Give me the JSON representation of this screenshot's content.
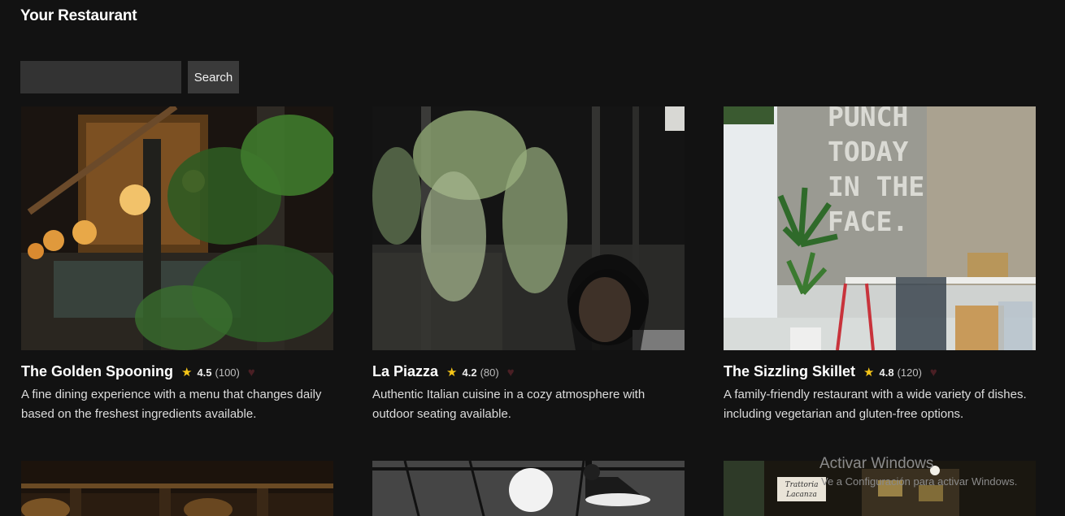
{
  "app": {
    "title": "Your Restaurant"
  },
  "search": {
    "placeholder": "",
    "value": "",
    "button_label": "Search"
  },
  "restaurants": [
    {
      "name": "The Golden Spooning",
      "star": "★",
      "rating": "4.5",
      "reviews": "(100)",
      "heart": "♥",
      "description": "A fine dining experience with a menu that changes daily based on the freshest ingredients available."
    },
    {
      "name": "La Piazza",
      "star": "★",
      "rating": "4.2",
      "reviews": "(80)",
      "heart": "♥",
      "description": "Authentic Italian cuisine in a cozy atmosphere with outdoor seating available."
    },
    {
      "name": "The Sizzling Skillet",
      "star": "★",
      "rating": "4.8",
      "reviews": "(120)",
      "heart": "♥",
      "description": "A family-friendly restaurant with a wide variety of dishes. including vegetarian and gluten-free options."
    }
  ],
  "wall_text": [
    "PUNCH",
    "TODAY",
    "IN THE",
    "FACE."
  ],
  "sign_text": [
    "Trattoria",
    "Lacanza"
  ],
  "watermark": {
    "title": "Activar Windows",
    "subtitle": "Ve a Configuración para activar Windows."
  },
  "colors": {
    "background": "#121212",
    "star": "#f5c518",
    "heart": "#4a1f24",
    "input": "#333333"
  }
}
